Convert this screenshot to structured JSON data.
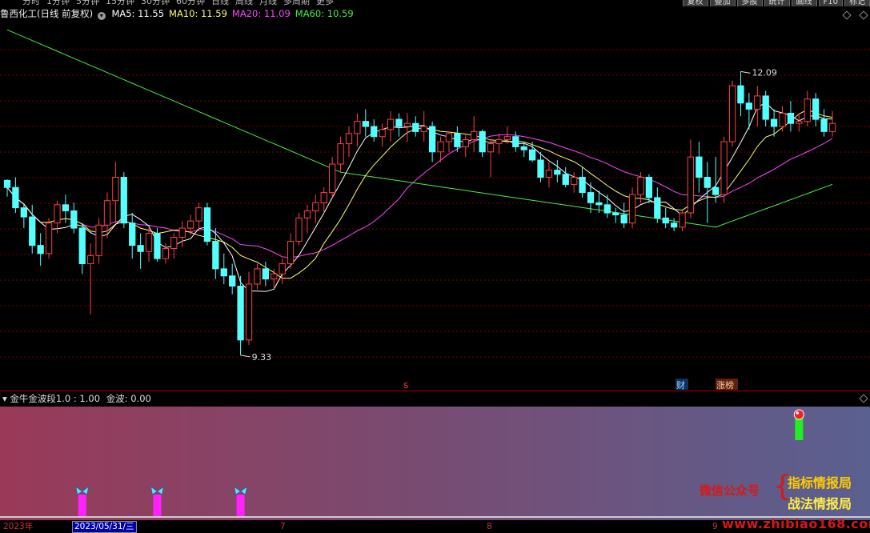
{
  "toolbar": {
    "tabs": [
      "分时",
      "1分钟",
      "5分钟",
      "15分钟",
      "30分钟",
      "60分钟",
      "日线",
      "周线",
      "月线",
      "多周期",
      "更多"
    ],
    "right_buttons": [
      "复权",
      "叠加",
      "多股",
      "统计",
      "画线",
      "F10",
      "标记"
    ]
  },
  "header": {
    "stock": "鲁西化工(日线 前复权)",
    "ma": [
      {
        "label": "MA5: 11.55",
        "color": "#ffffff"
      },
      {
        "label": "MA10: 11.59",
        "color": "#ffff66"
      },
      {
        "label": "MA20: 11.09",
        "color": "#ff44ff"
      },
      {
        "label": "MA60: 10.59",
        "color": "#44ee44"
      }
    ]
  },
  "annotations": {
    "high_label": "12.09",
    "low_label": "9.33",
    "event_s": "s",
    "event_cai": "财",
    "event_zhangbang": "涨榜"
  },
  "sub": {
    "indicator": "金牛金波段1.0 : 1.00",
    "jinbo": "金波: 0.00",
    "watermark_line1": "微信公众号",
    "watermark_brace": "{",
    "watermark_right1": "指标情报局",
    "watermark_right2": "战法情报局",
    "site": "www.zhibiao168.com"
  },
  "axis": {
    "year": "2023年",
    "cursor_date": "2023/05/31/三",
    "m7": "7",
    "m8": "8",
    "m9": "9"
  },
  "colors": {
    "up": "#ff4040",
    "down": "#54ffff",
    "ma5": "#ffffff",
    "ma10": "#ffff66",
    "ma20": "#ff44ff",
    "ma60": "#44ee44",
    "grid": "#7a0000"
  },
  "chart_data": {
    "type": "candlestick",
    "ylim": [
      9.0,
      12.4
    ],
    "ohlc": [
      [
        11.02,
        11.03,
        10.86,
        10.95
      ],
      [
        10.95,
        11.05,
        10.7,
        10.75
      ],
      [
        10.75,
        10.78,
        10.55,
        10.66
      ],
      [
        10.66,
        10.78,
        10.3,
        10.38
      ],
      [
        10.38,
        10.5,
        10.18,
        10.3
      ],
      [
        10.3,
        10.65,
        10.25,
        10.6
      ],
      [
        10.6,
        10.82,
        10.5,
        10.78
      ],
      [
        10.78,
        10.88,
        10.6,
        10.72
      ],
      [
        10.72,
        10.8,
        10.5,
        10.55
      ],
      [
        10.55,
        10.6,
        10.1,
        10.2
      ],
      [
        10.2,
        10.4,
        9.7,
        10.28
      ],
      [
        10.28,
        10.65,
        10.2,
        10.58
      ],
      [
        10.58,
        10.9,
        10.45,
        10.82
      ],
      [
        10.82,
        11.2,
        10.6,
        11.05
      ],
      [
        11.05,
        11.1,
        10.55,
        10.6
      ],
      [
        10.6,
        10.7,
        10.25,
        10.38
      ],
      [
        10.38,
        10.5,
        10.15,
        10.32
      ],
      [
        10.32,
        10.55,
        10.22,
        10.5
      ],
      [
        10.5,
        10.55,
        10.22,
        10.25
      ],
      [
        10.25,
        10.4,
        10.2,
        10.35
      ],
      [
        10.35,
        10.5,
        10.25,
        10.46
      ],
      [
        10.46,
        10.62,
        10.36,
        10.55
      ],
      [
        10.55,
        10.68,
        10.48,
        10.62
      ],
      [
        10.62,
        10.8,
        10.52,
        10.75
      ],
      [
        10.75,
        10.8,
        10.38,
        10.42
      ],
      [
        10.42,
        10.55,
        10.05,
        10.15
      ],
      [
        10.15,
        10.3,
        10.0,
        10.08
      ],
      [
        10.08,
        10.2,
        9.9,
        9.98
      ],
      [
        9.98,
        10.08,
        9.3,
        9.45
      ],
      [
        9.45,
        10.12,
        9.4,
        10.0
      ],
      [
        10.0,
        10.2,
        9.95,
        10.15
      ],
      [
        10.15,
        10.22,
        9.98,
        10.05
      ],
      [
        10.05,
        10.15,
        9.95,
        10.1
      ],
      [
        10.1,
        10.25,
        10.0,
        10.2
      ],
      [
        10.2,
        10.5,
        10.15,
        10.42
      ],
      [
        10.42,
        10.7,
        10.38,
        10.65
      ],
      [
        10.65,
        10.78,
        10.5,
        10.72
      ],
      [
        10.72,
        10.88,
        10.6,
        10.8
      ],
      [
        10.8,
        10.95,
        10.7,
        10.9
      ],
      [
        10.9,
        11.25,
        10.85,
        11.18
      ],
      [
        11.18,
        11.45,
        11.1,
        11.38
      ],
      [
        11.38,
        11.55,
        11.25,
        11.48
      ],
      [
        11.48,
        11.68,
        11.35,
        11.6
      ],
      [
        11.6,
        11.72,
        11.45,
        11.55
      ],
      [
        11.55,
        11.62,
        11.4,
        11.45
      ],
      [
        11.45,
        11.58,
        11.35,
        11.52
      ],
      [
        11.52,
        11.7,
        11.4,
        11.62
      ],
      [
        11.62,
        11.68,
        11.45,
        11.55
      ],
      [
        11.55,
        11.68,
        11.4,
        11.58
      ],
      [
        11.58,
        11.65,
        11.45,
        11.5
      ],
      [
        11.5,
        11.7,
        11.4,
        11.55
      ],
      [
        11.55,
        11.6,
        11.2,
        11.3
      ],
      [
        11.3,
        11.45,
        11.2,
        11.4
      ],
      [
        11.4,
        11.5,
        11.3,
        11.48
      ],
      [
        11.48,
        11.55,
        11.3,
        11.35
      ],
      [
        11.35,
        11.48,
        11.25,
        11.42
      ],
      [
        11.42,
        11.65,
        11.3,
        11.5
      ],
      [
        11.5,
        11.52,
        11.25,
        11.3
      ],
      [
        11.3,
        11.42,
        11.05,
        11.38
      ],
      [
        11.38,
        11.48,
        11.28,
        11.42
      ],
      [
        11.42,
        11.55,
        11.38,
        11.45
      ],
      [
        11.45,
        11.5,
        11.3,
        11.35
      ],
      [
        11.35,
        11.4,
        11.25,
        11.32
      ],
      [
        11.32,
        11.4,
        11.2,
        11.22
      ],
      [
        11.22,
        11.3,
        11.0,
        11.05
      ],
      [
        11.05,
        11.2,
        10.95,
        11.12
      ],
      [
        11.12,
        11.22,
        11.0,
        11.08
      ],
      [
        11.08,
        11.15,
        10.95,
        10.98
      ],
      [
        10.98,
        11.1,
        10.9,
        11.05
      ],
      [
        11.05,
        11.15,
        10.85,
        10.9
      ],
      [
        10.9,
        11.0,
        10.7,
        10.8
      ],
      [
        10.8,
        10.92,
        10.7,
        10.78
      ],
      [
        10.78,
        10.88,
        10.65,
        10.7
      ],
      [
        10.7,
        10.75,
        10.6,
        10.68
      ],
      [
        10.68,
        10.8,
        10.55,
        10.6
      ],
      [
        10.6,
        10.95,
        10.55,
        10.88
      ],
      [
        10.88,
        11.1,
        10.8,
        11.05
      ],
      [
        11.05,
        11.08,
        10.8,
        10.85
      ],
      [
        10.85,
        10.95,
        10.6,
        10.65
      ],
      [
        10.65,
        10.75,
        10.55,
        10.6
      ],
      [
        10.6,
        10.65,
        10.52,
        10.56
      ],
      [
        10.56,
        10.72,
        10.52,
        10.7
      ],
      [
        10.7,
        11.42,
        10.65,
        11.25
      ],
      [
        11.25,
        11.4,
        10.9,
        11.05
      ],
      [
        11.05,
        11.2,
        10.6,
        10.95
      ],
      [
        10.95,
        11.25,
        10.8,
        10.88
      ],
      [
        10.88,
        11.45,
        10.8,
        11.4
      ],
      [
        11.4,
        12.0,
        11.35,
        11.95
      ],
      [
        11.95,
        12.09,
        11.65,
        11.78
      ],
      [
        11.78,
        11.88,
        11.52,
        11.72
      ],
      [
        11.72,
        11.95,
        11.55,
        11.85
      ],
      [
        11.85,
        11.9,
        11.55,
        11.62
      ],
      [
        11.62,
        11.72,
        11.45,
        11.55
      ],
      [
        11.55,
        11.75,
        11.5,
        11.68
      ],
      [
        11.68,
        11.8,
        11.5,
        11.58
      ],
      [
        11.58,
        11.68,
        11.5,
        11.6
      ],
      [
        11.6,
        11.9,
        11.55,
        11.82
      ],
      [
        11.82,
        11.88,
        11.55,
        11.62
      ],
      [
        11.62,
        11.72,
        11.45,
        11.5
      ],
      [
        11.5,
        11.7,
        11.45,
        11.58
      ]
    ],
    "signals": [
      {
        "type": "pink-bar",
        "index": 9
      },
      {
        "type": "pink-bar",
        "index": 18
      },
      {
        "type": "pink-bar",
        "index": 28
      },
      {
        "type": "green-bar",
        "index": 95
      }
    ]
  }
}
